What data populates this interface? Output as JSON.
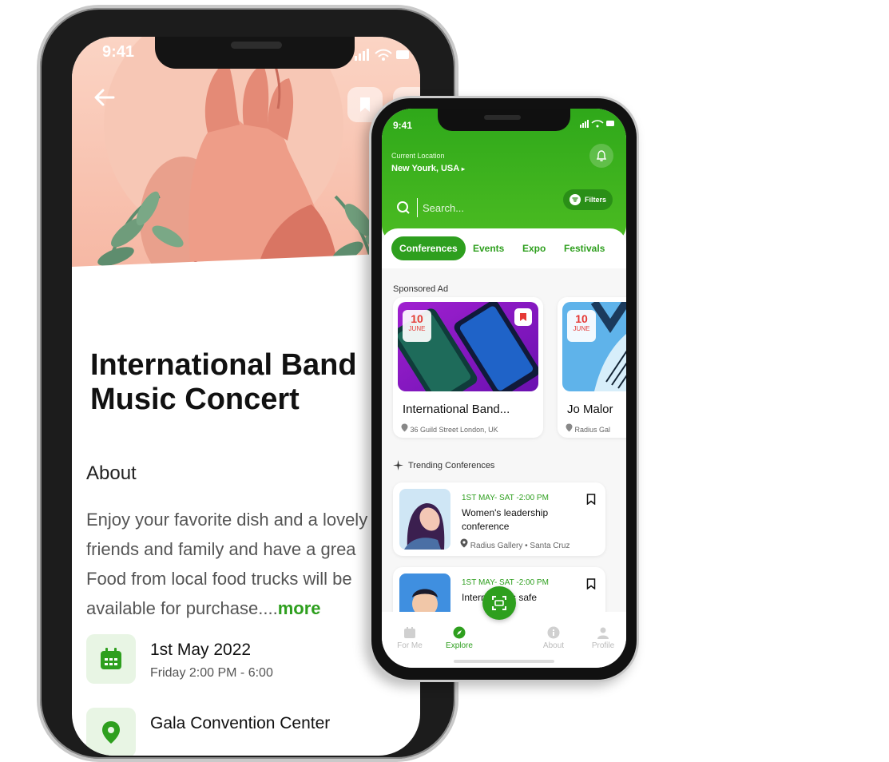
{
  "detail_screen": {
    "status_time": "9:41",
    "title_line1": "International Band",
    "title_line2": "Music Concert",
    "about_heading": "About",
    "about_lines": [
      "Enjoy your favorite dish and a lovely",
      "friends and family and have a grea",
      "Food from local food trucks will be",
      "available for purchase...."
    ],
    "more_link": "more",
    "date_title": "1st  May 2022",
    "date_sub": "Friday 2:00 PM - 6:00",
    "venue_title": "Gala Convention Center",
    "icons": [
      "back-arrow-icon",
      "bookmark-icon",
      "share-icon",
      "calendar-icon",
      "location-pin-icon"
    ]
  },
  "explore_screen": {
    "status_time": "9:41",
    "location_label": "Current Location",
    "location_value": "New Yourk, USA",
    "search_placeholder": "Search...",
    "filters_label": "Filters",
    "tabs": [
      "Conferences",
      "Events",
      "Expo",
      "Festivals"
    ],
    "active_tab": "Conferences",
    "sponsored_label": "Sponsored Ad",
    "ads": [
      {
        "day": "10",
        "month": "JUNE",
        "title": "International Band...",
        "address": "36 Guild Street London, UK"
      },
      {
        "day": "10",
        "month": "JUNE",
        "title": "Jo Malor",
        "address": "Radius Gal"
      }
    ],
    "trending_label": "Trending Conferences",
    "trending": [
      {
        "date": "1ST  MAY- SAT -2:00 PM",
        "title": "Women's leadership conference",
        "location": "Radius Gallery • Santa Cruz"
      },
      {
        "date": "1ST  MAY- SAT -2:00 PM",
        "title": "Intern   al kids safe",
        "location": ""
      }
    ],
    "nav": [
      "For Me",
      "Explore",
      "About",
      "Profile"
    ],
    "active_nav": "Explore",
    "brand_color": "#2e9f1e",
    "badge_color": "#e53935"
  }
}
